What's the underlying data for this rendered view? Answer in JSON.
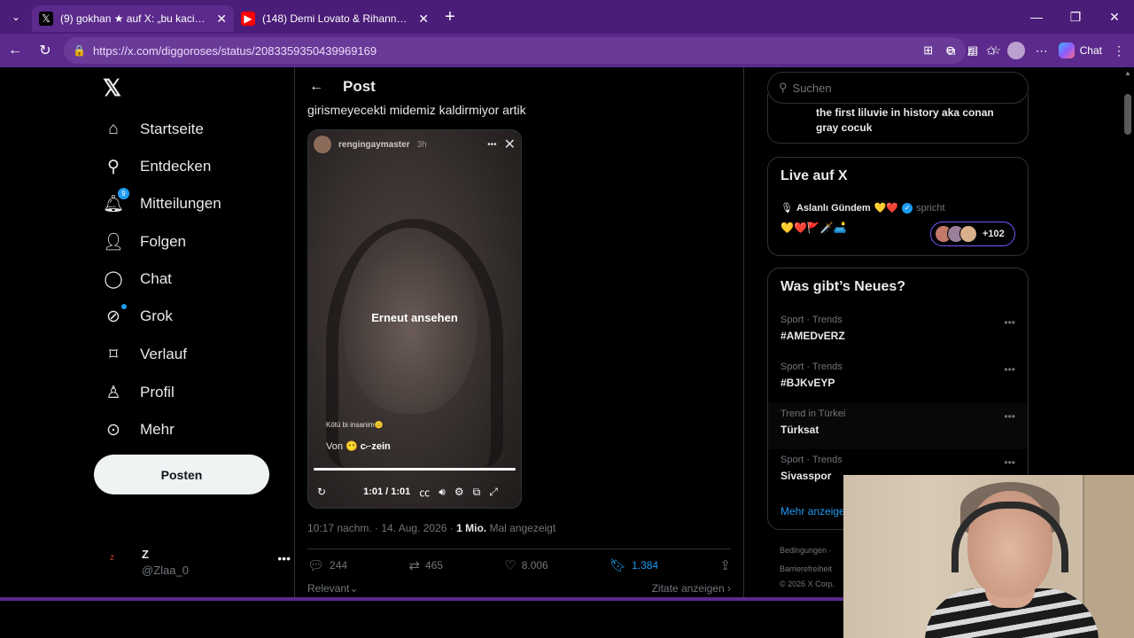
{
  "browser": {
    "tabs": [
      {
        "title": "(9) gokhan ★ auf X: „bu kacinci olc",
        "favicon": "x-icon",
        "active": true
      },
      {
        "title": "(148) Demi Lovato & Rihanna - Sta",
        "favicon": "youtube-icon",
        "active": false
      }
    ],
    "url": "https://x.com/diggoroses/status/2083359350439969169",
    "chat_label": "Chat"
  },
  "nav": {
    "items": [
      {
        "label": "Startseite",
        "icon": "home-icon"
      },
      {
        "label": "Entdecken",
        "icon": "search-icon"
      },
      {
        "label": "Mitteilungen",
        "icon": "bell-icon",
        "badge": "9"
      },
      {
        "label": "Folgen",
        "icon": "follow-icon"
      },
      {
        "label": "Chat",
        "icon": "chat-icon"
      },
      {
        "label": "Grok",
        "icon": "grok-icon"
      },
      {
        "label": "Verlauf",
        "icon": "bookmark-icon"
      },
      {
        "label": "Profil",
        "icon": "profile-icon"
      },
      {
        "label": "Mehr",
        "icon": "more-icon"
      }
    ],
    "post_button": "Posten",
    "account": {
      "name": "Z",
      "handle": "@Zlaa_0"
    }
  },
  "post": {
    "header": "Post",
    "text": "girismeyecekti midemiz kaldirmiyor artik",
    "video": {
      "user": "rengingaymaster",
      "time": "3h",
      "rewatch": "Erneut ansehen",
      "caption1": "Kötü bi insanim😑",
      "caption_from": "Von",
      "caption_user": "c⌐zein",
      "time_display": "1:01 / 1:01",
      "progress": 1.0
    },
    "meta": {
      "time": "10:17 nachm. · 14. Aug. 2026 · ",
      "views": "1 Mio.",
      "views_label": " Mal angezeigt"
    },
    "actions": {
      "replies": "244",
      "reposts": "465",
      "likes": "8.006",
      "bookmarks": "1.384"
    },
    "relevant": "Relevant",
    "quotes": "Zitate anzeigen"
  },
  "right": {
    "search_placeholder": "Suchen",
    "card1_text": "the first liluvie in history aka conan gray cocuk",
    "live": {
      "title": "Live auf X",
      "host": "Aslanlı Gündem",
      "host_emoji": "💛❤️",
      "status": "spricht",
      "emojis": "💛❤️🚩🗡️🛋️",
      "count": "+102"
    },
    "news": {
      "title": "Was gibt’s Neues?",
      "trends": [
        {
          "category": "Sport · Trends",
          "name": "#AMEDvERZ"
        },
        {
          "category": "Sport · Trends",
          "name": "#BJKvEYP"
        },
        {
          "category": "Trend in Türkei",
          "name": "Türksat"
        },
        {
          "category": "Sport · Trends",
          "name": "Sivasspor"
        }
      ],
      "more": "Mehr anzeigen"
    },
    "footer": {
      "l1": "Bedingungen ·",
      "l2": "Barrierefreiheit",
      "l3": "© 2026 X Corp."
    }
  }
}
